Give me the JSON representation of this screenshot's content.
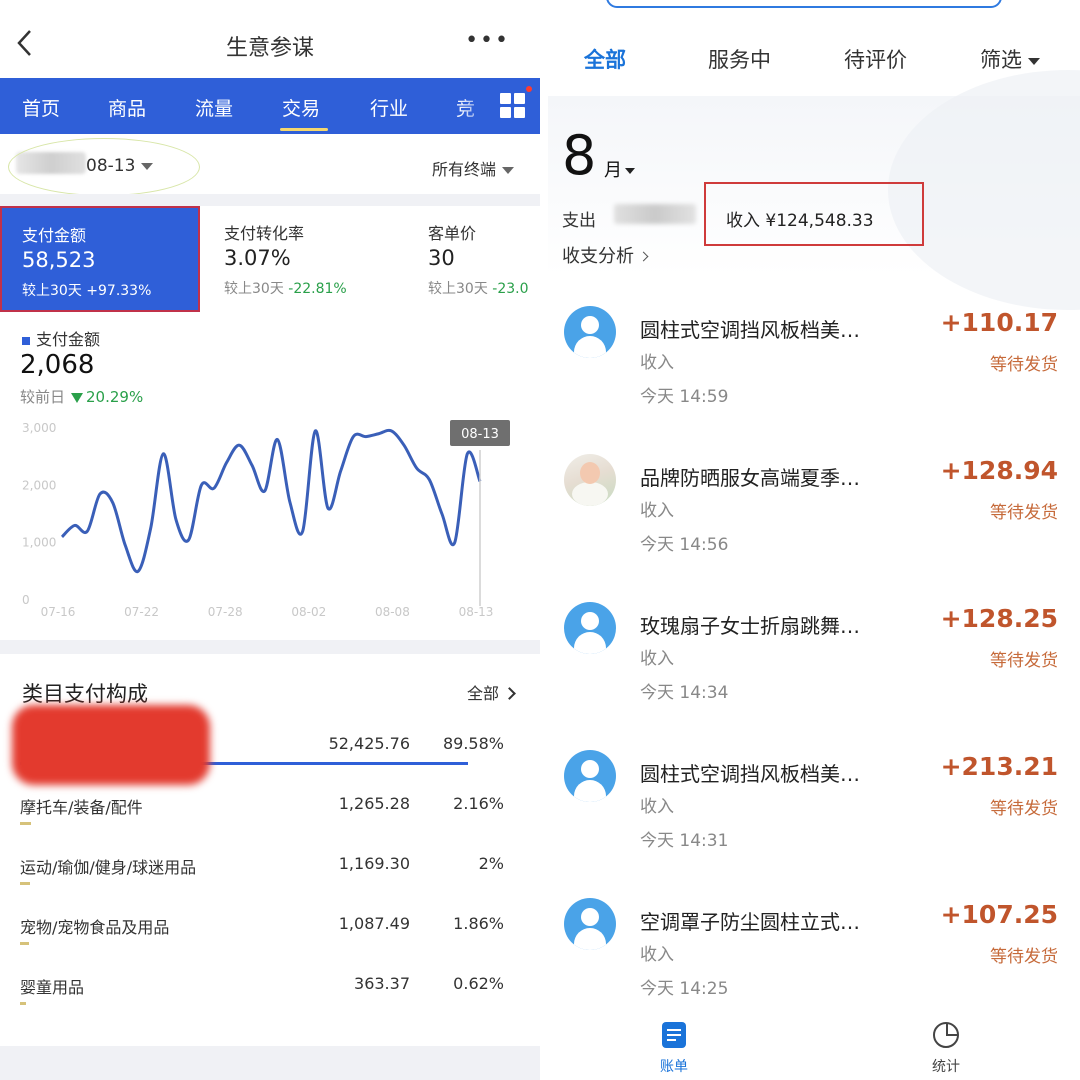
{
  "left": {
    "title": "生意参谋",
    "nav_tabs": [
      "首页",
      "商品",
      "流量",
      "交易",
      "行业",
      "竞"
    ],
    "active_tab": "交易",
    "date_visible": "08-13",
    "terminal_select": "所有终端",
    "kpis": [
      {
        "label": "支付金额",
        "value": "58,523",
        "cmp_label": "较上30天",
        "cmp_value": "+97.33%"
      },
      {
        "label": "支付转化率",
        "value": "3.07%",
        "cmp_label": "较上30天",
        "cmp_value": "-22.81%"
      },
      {
        "label": "客单价",
        "value": "30",
        "cmp_label": "较上30天",
        "cmp_value": "-23.0"
      }
    ],
    "metric": {
      "title": "支付金额",
      "value": "2,068",
      "cmp_label": "较前日",
      "cmp_value": "20.29%"
    },
    "category": {
      "title": "类目支付构成",
      "all_label": "全部",
      "rows": [
        {
          "name": "",
          "amount": "52,425.76",
          "pct": "89.58%",
          "share": 0.8958
        },
        {
          "name": "摩托车/装备/配件",
          "amount": "1,265.28",
          "pct": "2.16%",
          "share": 0.0216
        },
        {
          "name": "运动/瑜伽/健身/球迷用品",
          "amount": "1,169.30",
          "pct": "2%",
          "share": 0.02
        },
        {
          "name": "宠物/宠物食品及用品",
          "amount": "1,087.49",
          "pct": "1.86%",
          "share": 0.0186
        },
        {
          "name": "婴童用品",
          "amount": "363.37",
          "pct": "0.62%",
          "share": 0.0062
        }
      ]
    }
  },
  "chart_data": {
    "type": "line",
    "series": [
      {
        "values": [
          1100,
          1300,
          1200,
          1850,
          1700,
          950,
          500,
          1250,
          2550,
          1400,
          1050,
          2000,
          1950,
          2400,
          2700,
          2350,
          1900,
          2800,
          1700,
          1200,
          2950,
          1600,
          2250,
          2850,
          2850,
          2900,
          2950,
          2700,
          2300,
          2100,
          1500,
          1000,
          2550,
          2068
        ]
      }
    ],
    "yticks": [
      "3,000",
      "2,000",
      "1,000",
      "0"
    ],
    "xticks": [
      "07-16",
      "07-22",
      "07-28",
      "08-02",
      "08-08",
      "08-13"
    ],
    "ylim": [
      0,
      3000
    ],
    "tooltip": "08-13",
    "grid": false
  },
  "right": {
    "tabs": [
      "全部",
      "服务中",
      "待评价",
      "筛选"
    ],
    "active_tab": "全部",
    "month": "8",
    "month_unit": "月",
    "out_label": "支出",
    "income_label": "收入",
    "income_value": "¥124,548.33",
    "analysis_label": "收支分析",
    "transactions": [
      {
        "title": "圆柱式空调挡风板档美…",
        "type": "收入",
        "time": "今天  14:59",
        "amount": "+110.17",
        "status": "等待发货",
        "avatar": "default-avatar-icon"
      },
      {
        "title": "品牌防晒服女高端夏季…",
        "type": "收入",
        "time": "今天  14:56",
        "amount": "+128.94",
        "status": "等待发货",
        "avatar": "baby-photo-avatar"
      },
      {
        "title": "玫瑰扇子女士折扇跳舞…",
        "type": "收入",
        "time": "今天  14:34",
        "amount": "+128.25",
        "status": "等待发货",
        "avatar": "default-avatar-icon"
      },
      {
        "title": "圆柱式空调挡风板档美…",
        "type": "收入",
        "time": "今天  14:31",
        "amount": "+213.21",
        "status": "等待发货",
        "avatar": "default-avatar-icon"
      },
      {
        "title": "空调罩子防尘圆柱立式…",
        "type": "收入",
        "time": "今天  14:25",
        "amount": "+107.25",
        "status": "等待发货",
        "avatar": "default-avatar-icon"
      }
    ],
    "bottom_nav": [
      {
        "label": "账单",
        "icon": "bill-icon",
        "color": "#1a73d9"
      },
      {
        "label": "统计",
        "icon": "pie-stat-icon",
        "color": "#444444"
      }
    ]
  },
  "colors": {
    "nav_blue": "#2f5fd8",
    "accent_blue": "#1a73d9",
    "amount_orange": "#c0552c",
    "highlight_red": "#cf3b3b",
    "down_green": "#2aa04a"
  }
}
